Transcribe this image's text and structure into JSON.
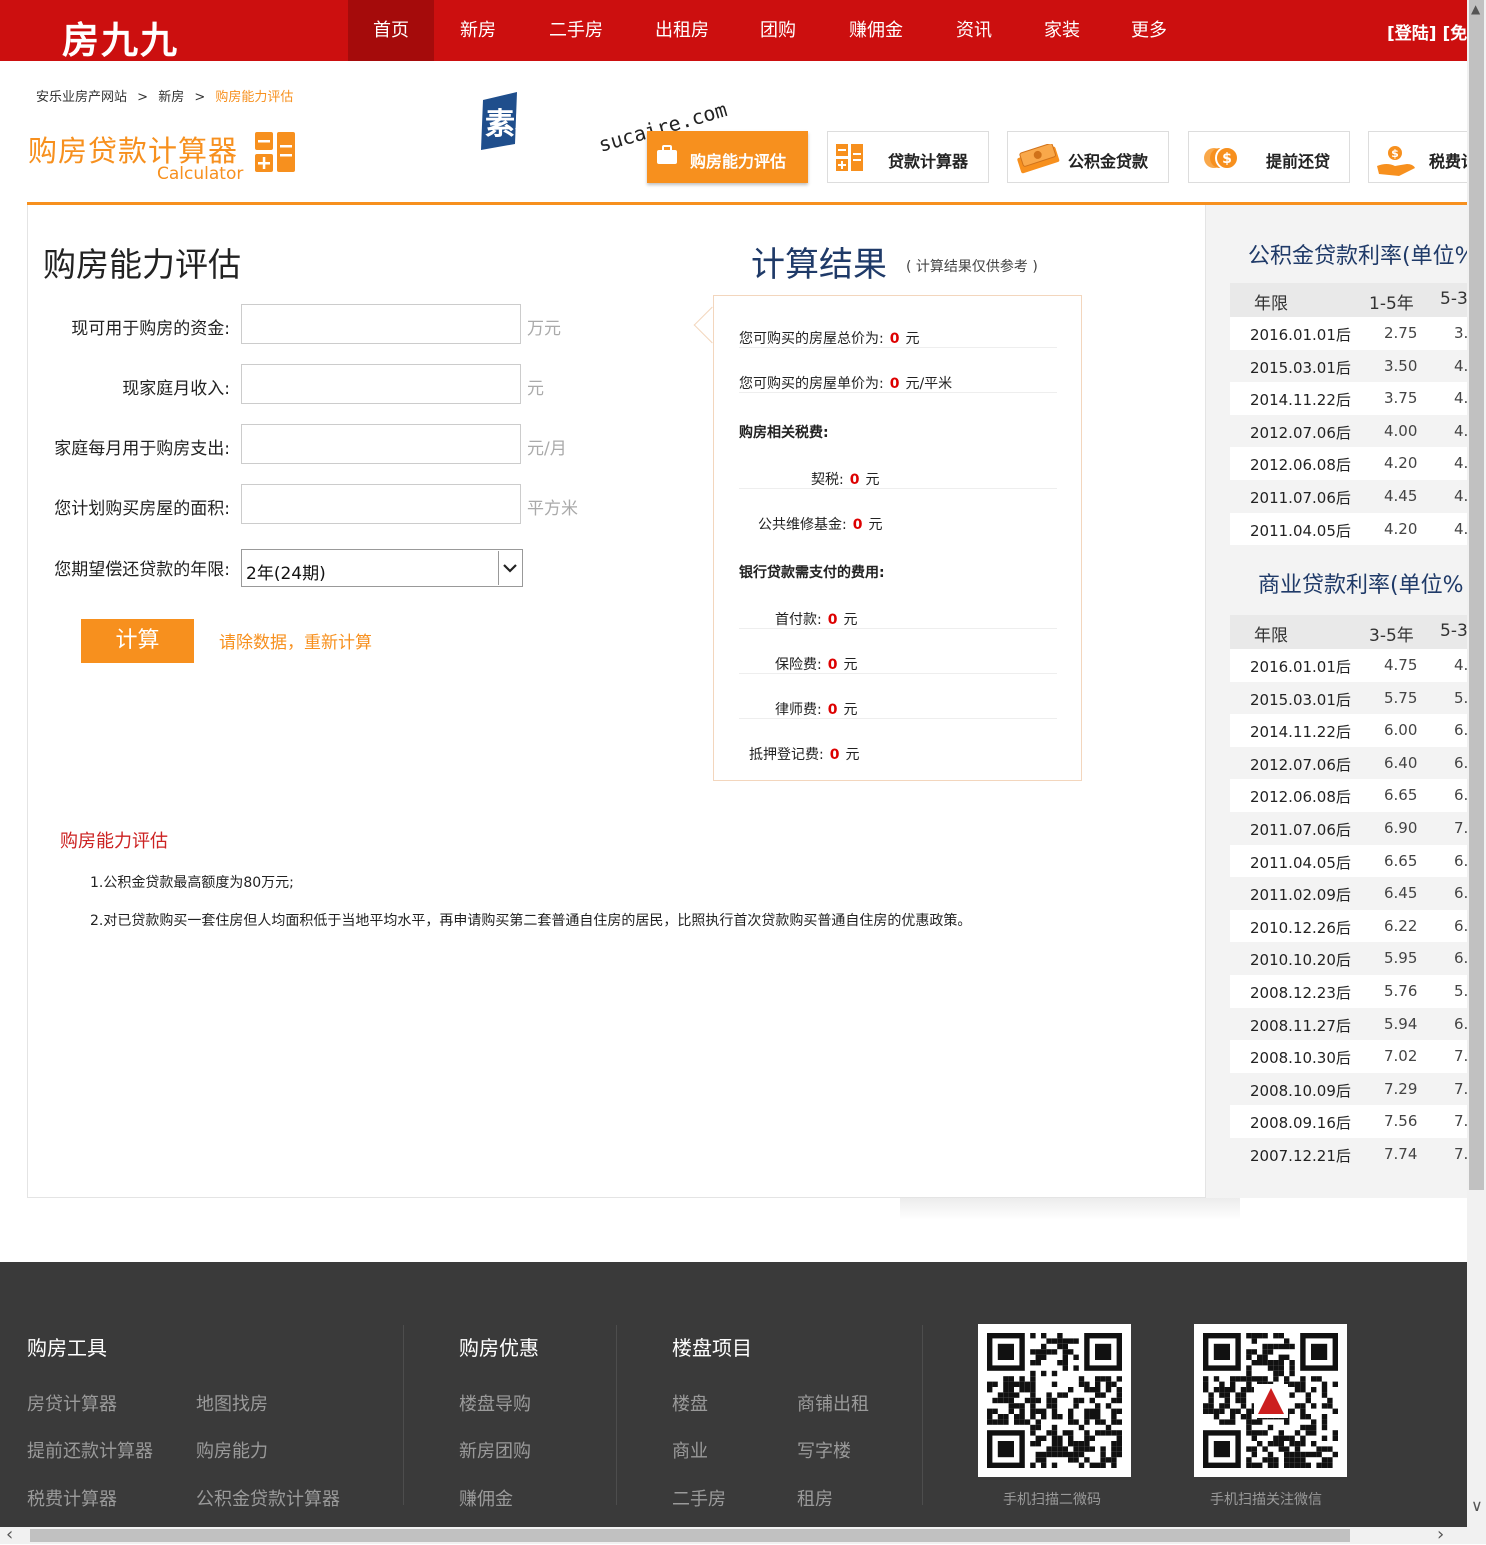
{
  "header": {
    "logo": "房九九",
    "nav": [
      {
        "label": "首页",
        "active": true
      },
      {
        "label": "新房"
      },
      {
        "label": "二手房"
      },
      {
        "label": "出租房"
      },
      {
        "label": "团购"
      },
      {
        "label": "赚佣金"
      },
      {
        "label": "资讯"
      },
      {
        "label": "家装"
      },
      {
        "label": "更多"
      }
    ],
    "login": "[登陆] [免"
  },
  "breadcrumb": {
    "home": "安乐业房产网站",
    "sep": ">",
    "level2": "新房",
    "current": "购房能力评估"
  },
  "calc_logo": {
    "title": "购房贷款计算器",
    "sub": "Calculator"
  },
  "watermark": {
    "cn": "素材熱",
    "en": "sucaire.com"
  },
  "tools": [
    {
      "label": "购房能力评估",
      "icon": "briefcase-icon",
      "active": true
    },
    {
      "label": "贷款计算器",
      "icon": "calculator-icon"
    },
    {
      "label": "公积金贷款",
      "icon": "money-stack-icon"
    },
    {
      "label": "提前还贷",
      "icon": "coins-icon"
    },
    {
      "label": "税费计",
      "icon": "hand-coin-icon"
    }
  ],
  "form": {
    "title": "购房能力评估",
    "fields": [
      {
        "label": "现可用于购房的资金:",
        "unit": "万元",
        "value": ""
      },
      {
        "label": "现家庭月收入:",
        "unit": "元",
        "value": ""
      },
      {
        "label": "家庭每月用于购房支出:",
        "unit": "元/月",
        "value": ""
      },
      {
        "label": "您计划购买房屋的面积:",
        "unit": "平方米",
        "value": ""
      }
    ],
    "select": {
      "label": "您期望偿还贷款的年限:",
      "value": "2年(24期)"
    },
    "submit": "计算",
    "reset": "请除数据，重新计算"
  },
  "result": {
    "title": "计算结果",
    "note": "( 计算结果仅供参考 )",
    "rows": [
      {
        "label": "您可购买的房屋总价为:",
        "value": "0",
        "unit": "元"
      },
      {
        "label": "您可购买的房屋单价为:",
        "value": "0",
        "unit": "元/平米"
      },
      {
        "label": "购房相关税费:",
        "header": true
      },
      {
        "label": "契税:",
        "value": "0",
        "unit": "元"
      },
      {
        "label": "公共维修基金:",
        "value": "0",
        "unit": "元"
      },
      {
        "label": "银行贷款需支付的费用:",
        "header": true
      },
      {
        "label": "首付款:",
        "value": "0",
        "unit": "元"
      },
      {
        "label": "保险费:",
        "value": "0",
        "unit": "元"
      },
      {
        "label": "律师费:",
        "value": "0",
        "unit": "元"
      },
      {
        "label": "抵押登记费:",
        "value": "0",
        "unit": "元"
      }
    ]
  },
  "notes": {
    "title": "购房能力评估",
    "items": [
      "1.公积金贷款最高额度为80万元;",
      "2.对已贷款购买一套住房但人均面积低于当地平均水平，再申请购买第二套普通自住房的居民，比照执行首次贷款购买普通自住房的优惠政策。"
    ]
  },
  "fund_rates": {
    "title": "公积金贷款利率(单位%",
    "headers": [
      "年限",
      "1-5年",
      "5-3"
    ],
    "rows": [
      [
        "2016.01.01后",
        "2.75",
        "3."
      ],
      [
        "2015.03.01后",
        "3.50",
        "4."
      ],
      [
        "2014.11.22后",
        "3.75",
        "4."
      ],
      [
        "2012.07.06后",
        "4.00",
        "4."
      ],
      [
        "2012.06.08后",
        "4.20",
        "4."
      ],
      [
        "2011.07.06后",
        "4.45",
        "4."
      ],
      [
        "2011.04.05后",
        "4.20",
        "4."
      ]
    ]
  },
  "biz_rates": {
    "title": "商业贷款利率(单位%",
    "headers": [
      "年限",
      "3-5年",
      "5-3"
    ],
    "rows": [
      [
        "2016.01.01后",
        "4.75",
        "4."
      ],
      [
        "2015.03.01后",
        "5.75",
        "5."
      ],
      [
        "2014.11.22后",
        "6.00",
        "6."
      ],
      [
        "2012.07.06后",
        "6.40",
        "6."
      ],
      [
        "2012.06.08后",
        "6.65",
        "6."
      ],
      [
        "2011.07.06后",
        "6.90",
        "7."
      ],
      [
        "2011.04.05后",
        "6.65",
        "6."
      ],
      [
        "2011.02.09后",
        "6.45",
        "6."
      ],
      [
        "2010.12.26后",
        "6.22",
        "6."
      ],
      [
        "2010.10.20后",
        "5.95",
        "6."
      ],
      [
        "2008.12.23后",
        "5.76",
        "5."
      ],
      [
        "2008.11.27后",
        "5.94",
        "6."
      ],
      [
        "2008.10.30后",
        "7.02",
        "7."
      ],
      [
        "2008.10.09后",
        "7.29",
        "7."
      ],
      [
        "2008.09.16后",
        "7.56",
        "7."
      ],
      [
        "2007.12.21后",
        "7.74",
        "7."
      ]
    ]
  },
  "footer": {
    "cols": [
      {
        "title": "购房工具",
        "links": [
          "房贷计算器",
          "地图找房",
          "提前还款计算器",
          "购房能力",
          "税费计算器",
          "公积金贷款计算器"
        ]
      },
      {
        "title": "购房优惠",
        "links": [
          "楼盘导购",
          "新房团购",
          "赚佣金"
        ]
      },
      {
        "title": "楼盘项目",
        "links": [
          "楼盘",
          "商铺出租",
          "商业",
          "写字楼",
          "二手房",
          "租房"
        ]
      }
    ],
    "qr": [
      {
        "caption": "手机扫描二微码"
      },
      {
        "caption": "手机扫描关注微信"
      }
    ]
  },
  "colors": {
    "brand_red": "#cc0f0f",
    "accent_orange": "#f7901e",
    "title_blue": "#1f3a68",
    "footer_bg": "#3a3a3a"
  }
}
